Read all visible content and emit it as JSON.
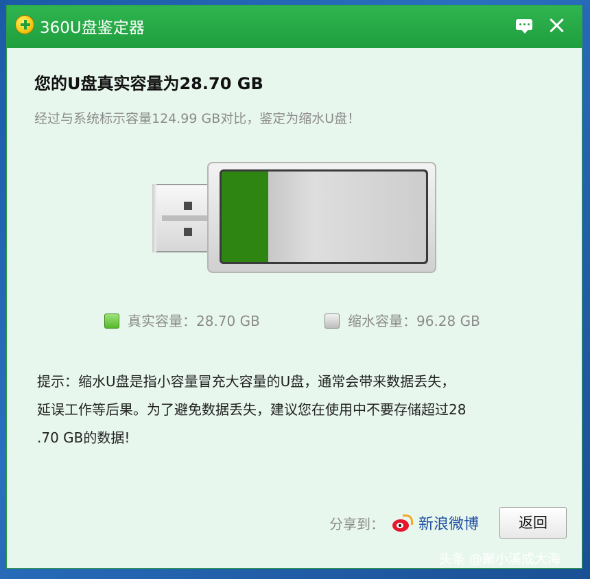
{
  "window": {
    "title": "360U盘鉴定器",
    "icons": {
      "logo": "360-plus-logo-icon",
      "feedback": "chat-bubble-icon",
      "close": "close-icon"
    }
  },
  "result": {
    "heading": "您的U盘真实容量为28.70 GB",
    "comparison": "经过与系统标示容量124.99 GB对比，鉴定为缩水U盘！"
  },
  "usb_meter": {
    "real_fraction": 0.2296,
    "fill_color": "#2f8512"
  },
  "legend": {
    "real": "真实容量：28.70 GB",
    "shrink": "缩水容量：96.28 GB",
    "colors": {
      "real": "#56b82b",
      "shrink": "#bdbdbd"
    }
  },
  "tip": {
    "lines": [
      "提示：缩水U盘是指小容量冒充大容量的U盘，通常会带来数据丢失，",
      "延误工作等后果。为了避免数据丢失，建议您在使用中不要存储超过28",
      ".70 GB的数据!"
    ]
  },
  "footer": {
    "share_label": "分享到：",
    "weibo_label": "新浪微博",
    "weibo_icon": "sina-weibo-icon",
    "back_label": "返回"
  },
  "watermark": "头条 @聚小溪成大海"
}
